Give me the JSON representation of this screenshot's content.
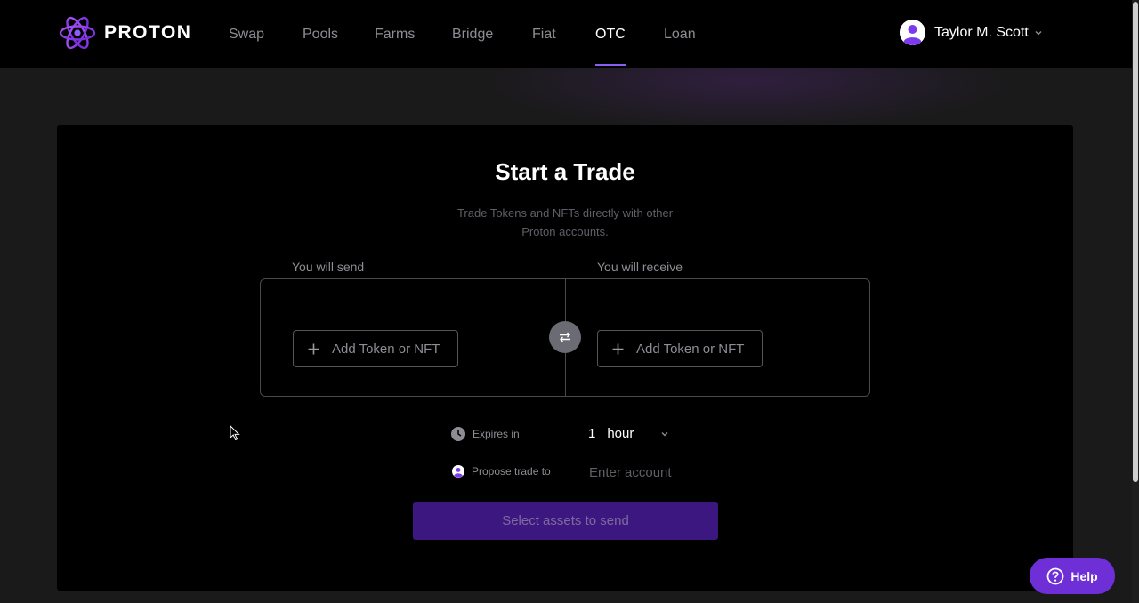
{
  "header": {
    "brand": "PROTON",
    "nav": [
      {
        "label": "Swap"
      },
      {
        "label": "Pools"
      },
      {
        "label": "Farms"
      },
      {
        "label": "Bridge"
      },
      {
        "label": "Fiat"
      },
      {
        "label": "OTC",
        "active": true
      },
      {
        "label": "Loan"
      }
    ],
    "user": {
      "name": "Taylor M. Scott",
      "icon": "user-avatar-icon"
    }
  },
  "trade": {
    "title": "Start a Trade",
    "subtitle_line1": "Trade Tokens and NFTs directly with other",
    "subtitle_line2": "Proton accounts.",
    "send_label": "You will send",
    "receive_label": "You will receive",
    "add_send_label": "Add Token or NFT",
    "add_receive_label": "Add Token or NFT",
    "expires_label": "Expires in",
    "expires_value": "1",
    "expires_unit": "hour",
    "propose_label": "Propose trade to",
    "account_placeholder": "Enter account",
    "submit_label": "Select assets to send"
  },
  "help": {
    "label": "Help"
  },
  "colors": {
    "accent": "#8b5cf6",
    "help_bg": "#6e2fd6",
    "submit_bg": "#3d1780",
    "background": "#1a1a1a",
    "panel": "#000000"
  }
}
